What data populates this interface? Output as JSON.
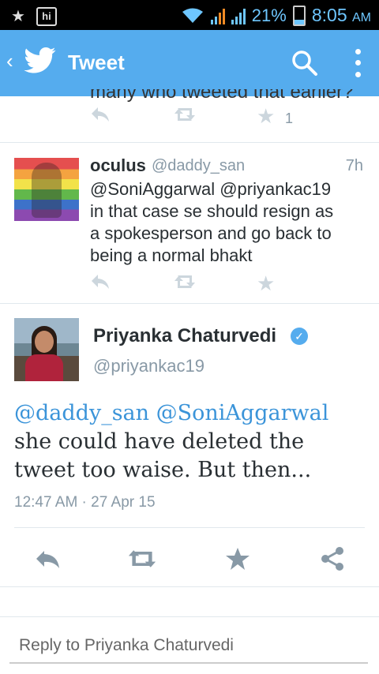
{
  "status_bar": {
    "battery": "21%",
    "time": "8:05",
    "ampm": "AM",
    "hi_label": "hi"
  },
  "app_bar": {
    "title": "Tweet"
  },
  "prev_tweet": {
    "cut_text": "many who tweeted that earlier?",
    "favorite_count": "1"
  },
  "reply_tweet": {
    "name": "oculus",
    "handle": "@daddy_san",
    "time": "7h",
    "text_lines": [
      "@SoniAggarwal @priyankac19",
      "in that case se should resign as",
      "a spokesperson and go back to",
      "being a normal bhakt"
    ]
  },
  "main_tweet": {
    "name": "Priyanka Chaturvedi",
    "handle": "@priyankac19",
    "mention1": "@daddy_san",
    "mention2": "@SoniAggarwal",
    "line1_rest": "",
    "line2": "she could have deleted the",
    "line3": "tweet too waise. But then...",
    "timestamp": "12:47 AM · 27 Apr 15"
  },
  "reply_field": {
    "placeholder": "Reply to Priyanka Chaturvedi"
  },
  "colors": {
    "brand": "#55acee",
    "mention": "#3b94d9",
    "muted": "#8899a6"
  }
}
